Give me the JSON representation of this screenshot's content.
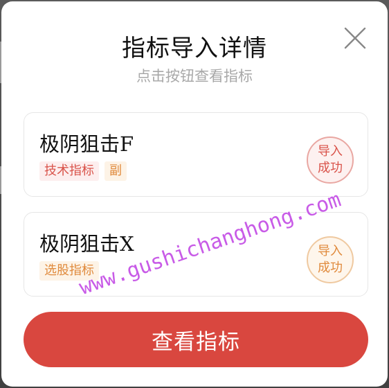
{
  "dialog": {
    "title": "指标导入详情",
    "subtitle": "点击按钮查看指标"
  },
  "indicators": [
    {
      "name": "极阴狙击F",
      "tags": [
        "技术指标",
        "副"
      ],
      "status_line1": "导入",
      "status_line2": "成功"
    },
    {
      "name": "极阴狙击X",
      "tags": [
        "选股指标"
      ],
      "status_line1": "导入",
      "status_line2": "成功"
    }
  ],
  "actions": {
    "view_label": "查看指标"
  },
  "watermark": {
    "text": "www.gushichanghong.com"
  },
  "icons": {
    "close": "close-icon"
  },
  "colors": {
    "accent": "#d9473f",
    "tag_red": "#d9534a",
    "tag_orange": "#e08a3c",
    "watermark": "#c653e6"
  }
}
